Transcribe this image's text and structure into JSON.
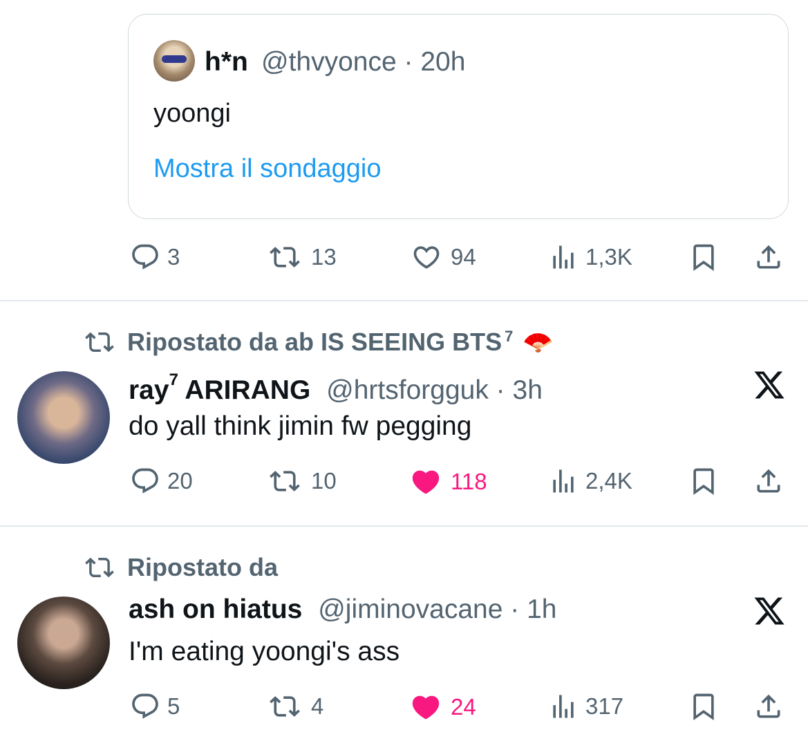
{
  "quote": {
    "name": "h*n",
    "handle_time": "@thvyonce · 20h",
    "text": "yoongi",
    "poll_link": "Mostra il sondaggio"
  },
  "tweet0_actions": {
    "replies": "3",
    "reposts": "13",
    "likes": "94",
    "views": "1,3K"
  },
  "tweet1": {
    "repost_label": "Ripostato da ab IS SEEING BTS",
    "repost_sup": "7",
    "repost_emoji": "🪭",
    "name": "ray",
    "name_sup": "7",
    "name_rest": " ARIRANG",
    "handle_time": "@hrtsforgguk · 3h",
    "text": "do yall think jimin fw pegging",
    "replies": "20",
    "reposts": "10",
    "likes": "118",
    "views": "2,4K"
  },
  "tweet2": {
    "repost_label": "Ripostato da",
    "name": "ash on hiatus",
    "handle_time": "@jiminovacane · 1h",
    "text": "I'm eating yoongi's ass",
    "replies": "5",
    "reposts": "4",
    "likes": "24",
    "views": "317"
  },
  "colors": {
    "accent": "#1d9bf0",
    "like": "#f91880",
    "muted": "#536471"
  }
}
